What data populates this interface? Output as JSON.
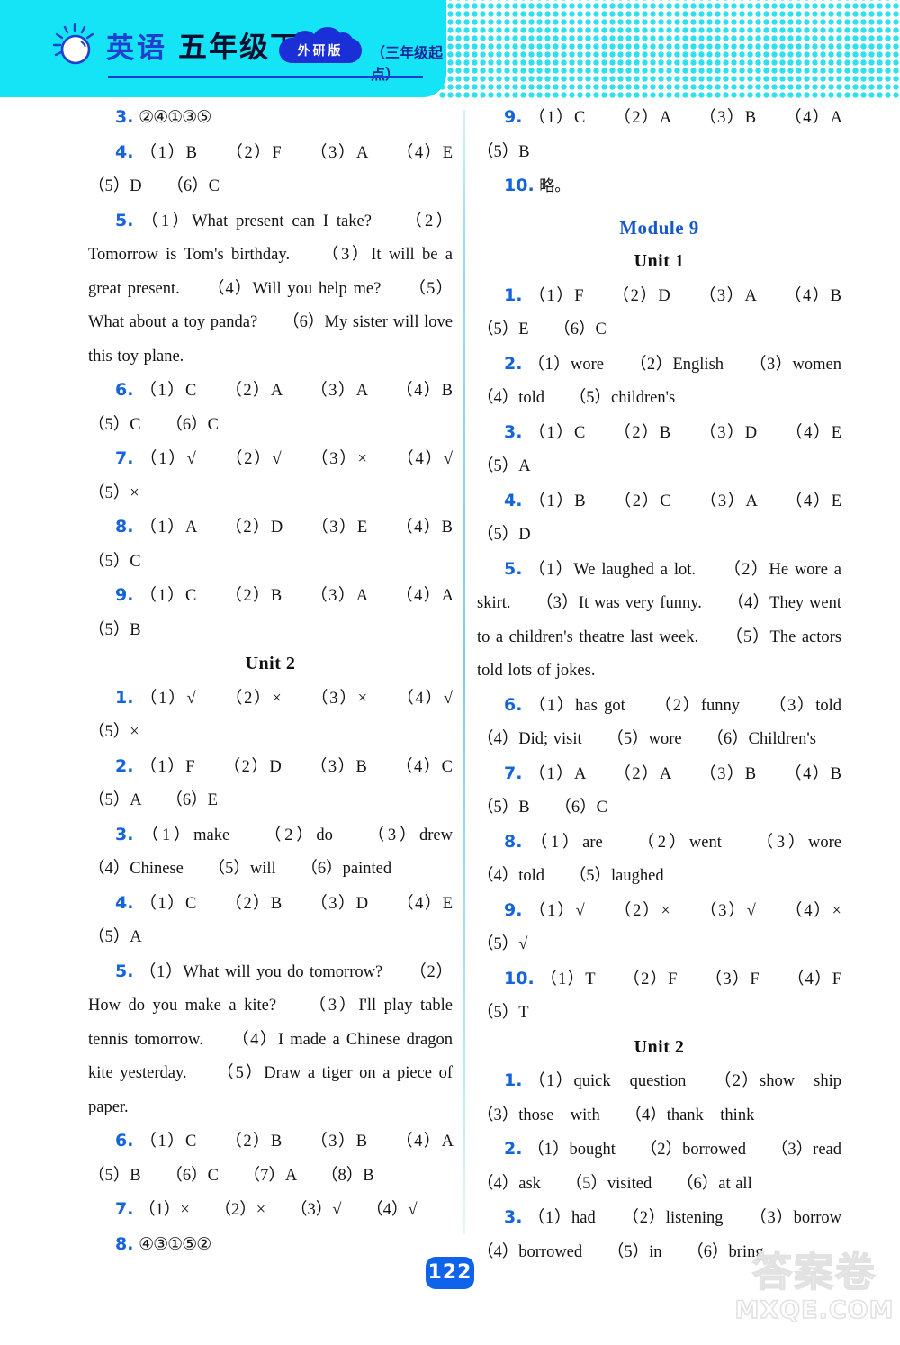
{
  "header": {
    "subject_cn": "英语",
    "grade_cn": "五年级下",
    "publisher_badge": "外研版",
    "start_note": "（三年级起点）",
    "sun_icon": "sun-icon"
  },
  "left_column": {
    "blocks": [
      {
        "type": "answer",
        "num": "3.",
        "text": "②④①③⑤",
        "style": "circled"
      },
      {
        "type": "answer",
        "num": "4.",
        "text": "（1）B　　（2）F　　（3）A　　（4）E　　（5）D　　（6）C"
      },
      {
        "type": "answer",
        "num": "5.",
        "text": "（1）What present can I take?　　（2）Tomorrow is Tom's birthday.　　（3）It will be a great present.　　（4）Will you help me?　　（5）What about a toy panda?　　（6）My sister will love this toy plane."
      },
      {
        "type": "answer",
        "num": "6.",
        "text": "（1）C　　（2）A　　（3）A　　（4）B　　（5）C　　（6）C"
      },
      {
        "type": "answer",
        "num": "7.",
        "text": "（1）√　　（2）√　　（3）×　　（4）√　　（5）×"
      },
      {
        "type": "answer",
        "num": "8.",
        "text": "（1）A　　（2）D　　（3）E　　（4）B　　（5）C"
      },
      {
        "type": "answer",
        "num": "9.",
        "text": "（1）C　　（2）B　　（3）A　　（4）A　　（5）B"
      },
      {
        "type": "heading_unit",
        "text": "Unit 2"
      },
      {
        "type": "answer",
        "num": "1.",
        "text": "（1）√　　（2）×　　（3）×　　（4）√　　（5）×"
      },
      {
        "type": "answer",
        "num": "2.",
        "text": "（1）F　　（2）D　　（3）B　　（4）C　　（5）A　　（6）E"
      },
      {
        "type": "answer",
        "num": "3.",
        "text": "（1）make　　（2）do　　（3）drew　　（4）Chinese　　（5）will　　（6）painted"
      },
      {
        "type": "answer",
        "num": "4.",
        "text": "（1）C　　（2）B　　（3）D　　（4）E　　（5）A"
      },
      {
        "type": "answer",
        "num": "5.",
        "text": "（1）What will you do tomorrow?　　（2）How do you make a kite?　　（3）I'll play table tennis tomorrow.　　（4）I made a Chinese dragon kite yesterday.　　（5）Draw a tiger on a piece of paper."
      },
      {
        "type": "answer",
        "num": "6.",
        "text": "（1）C　　（2）B　　（3）B　　（4）A　　（5）B　　（6）C　　（7）A　　（8）B"
      },
      {
        "type": "answer",
        "num": "7.",
        "text": "（1）×　　（2）×　　（3）√　　（4）√"
      },
      {
        "type": "answer",
        "num": "8.",
        "text": "④③①⑤②",
        "style": "circled"
      }
    ]
  },
  "right_column": {
    "blocks": [
      {
        "type": "answer",
        "num": "9.",
        "text": "（1）C　　（2）A　　（3）B　　（4）A　　（5）B"
      },
      {
        "type": "answer",
        "num": "10.",
        "text": "略。",
        "style": "cn"
      },
      {
        "type": "heading_module",
        "text": "Module 9"
      },
      {
        "type": "heading_unit",
        "text": "Unit 1"
      },
      {
        "type": "answer",
        "num": "1.",
        "text": "（1）F　　（2）D　　（3）A　　（4）B　　（5）E　　（6）C"
      },
      {
        "type": "answer",
        "num": "2.",
        "text": "（1）wore　　（2）English　　（3）women　　（4）told　　（5）children's"
      },
      {
        "type": "answer",
        "num": "3.",
        "text": "（1）C　　（2）B　　（3）D　　（4）E　　（5）A"
      },
      {
        "type": "answer",
        "num": "4.",
        "text": "（1）B　　（2）C　　（3）A　　（4）E　　（5）D"
      },
      {
        "type": "answer",
        "num": "5.",
        "text": "（1）We laughed a lot.　　（2）He wore a skirt.　　（3）It was very funny.　　（4）They went to a children's theatre last week.　　（5）The actors told lots of jokes."
      },
      {
        "type": "answer",
        "num": "6.",
        "text": "（1）has got　　（2）funny　　（3）told　　（4）Did; visit　　（5）wore　　（6）Children's"
      },
      {
        "type": "answer",
        "num": "7.",
        "text": "（1）A　　（2）A　　（3）B　　（4）B　　（5）B　　（6）C"
      },
      {
        "type": "answer",
        "num": "8.",
        "text": "（1）are　　（2）went　　（3）wore　　（4）told　　（5）laughed"
      },
      {
        "type": "answer",
        "num": "9.",
        "text": "（1）√　　（2）×　　（3）√　　（4）×　　（5）√"
      },
      {
        "type": "answer",
        "num": "10.",
        "text": "（1）T　　（2）F　　（3）F　　（4）F　　（5）T"
      },
      {
        "type": "heading_unit",
        "text": "Unit 2"
      },
      {
        "type": "answer",
        "num": "1.",
        "text": "（1）quick　question　　（2）show　ship　　（3）those　with　　（4）thank　think"
      },
      {
        "type": "answer",
        "num": "2.",
        "text": "（1）bought　　（2）borrowed　　（3）read　　（4）ask　　（5）visited　　（6）at all"
      },
      {
        "type": "answer",
        "num": "3.",
        "text": "（1）had　　（2）listening　　（3）borrow　　（4）borrowed　　（5）in　　（6）bring"
      }
    ]
  },
  "footer": {
    "page_number": "122",
    "watermark_cn": "答案卷",
    "watermark_en": "MXQE.COM"
  },
  "colors": {
    "header_cyan": "#14e4f5",
    "accent_blue": "#1565d8",
    "module_blue": "#1558c8",
    "badge_blue": "#0e63ea"
  }
}
